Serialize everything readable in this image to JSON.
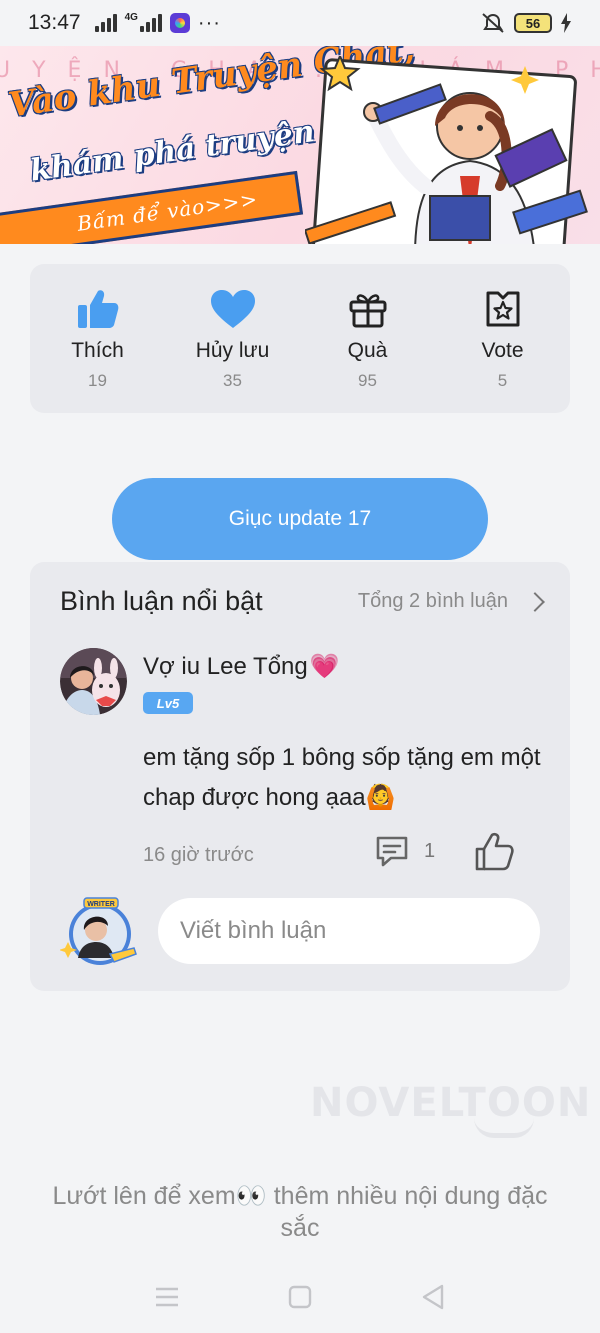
{
  "status_bar": {
    "time": "13:47",
    "network": "4G",
    "more": "···",
    "battery": "56"
  },
  "banner": {
    "bg_text": "UYỆN CHAT. KHÁM PHÁ",
    "title_line1": "Vào khu Truyện Chat,",
    "title_line2": "khám phá truyện chất",
    "cta": "Bấm để vào>>>"
  },
  "stats": [
    {
      "icon": "thumbs-up-icon",
      "label": "Thích",
      "count": "19"
    },
    {
      "icon": "heart-icon",
      "label": "Hủy lưu",
      "count": "35"
    },
    {
      "icon": "gift-icon",
      "label": "Quà",
      "count": "95"
    },
    {
      "icon": "vote-badge-icon",
      "label": "Vote",
      "count": "5"
    }
  ],
  "urge_button": "Giục update 17",
  "comments": {
    "title": "Bình luận nổi bật",
    "total": "Tổng 2 bình luận",
    "items": [
      {
        "user": "Vợ iu Lee Tổng",
        "user_emoji": "💗",
        "level": "Lv5",
        "text": "em tặng sốp 1 bông sốp tặng em một chap được hong ạaa🙆",
        "time": "16 giờ trước",
        "reply_count": "1"
      }
    ],
    "input_placeholder": "Viết bình luận",
    "my_avatar_badge": "WRITER"
  },
  "watermark": "NOVELTOON",
  "swipe_hint": "Lướt lên để xem👀 thêm nhiều nội dung đặc sắc",
  "colors": {
    "accent": "#5aa6f0",
    "icon_blue": "#4a9ef0",
    "banner_orange": "#ff8a1e",
    "banner_navy": "#1c3d82",
    "card_bg": "#e9eaee",
    "page_bg": "#f3f4f6"
  }
}
